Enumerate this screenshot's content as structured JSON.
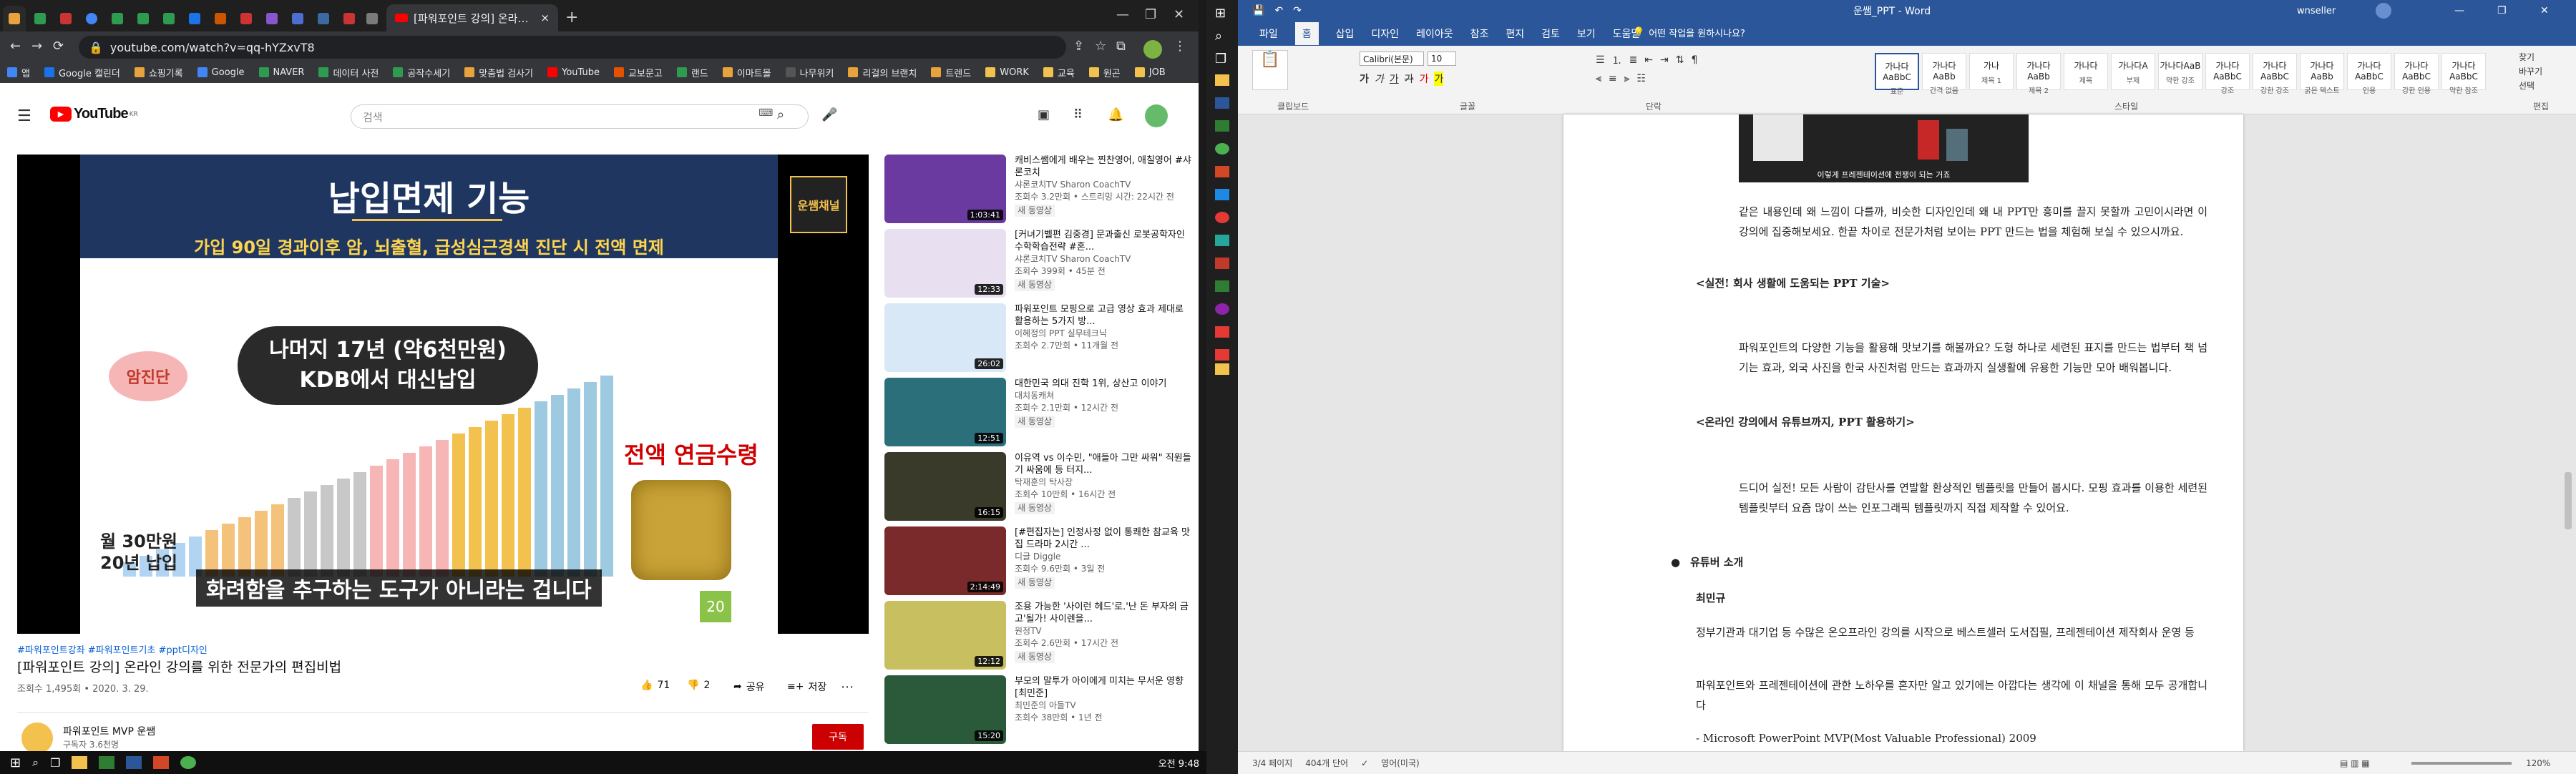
{
  "browser": {
    "active_tab_title": "[파워포인트 강의] 온라인 강의를 위한 전문가의 편집비법",
    "url": "youtube.com/watch?v=qq-hYZxvT8",
    "bookmarks": [
      "앱",
      "Google 캘린더",
      "쇼핑기록",
      "Google",
      "NAVER",
      "데이터 사전",
      "공작수세기",
      "맞춤법 검사기",
      "YouTube",
      "교보문고",
      "랜드",
      "이마트몰",
      "나무위키",
      "리걸의 브랜치",
      "트렌드",
      "WORK",
      "교육",
      "원곤",
      "JOB"
    ]
  },
  "youtube": {
    "logo": "YouTube",
    "logo_sup": "KR",
    "search_placeholder": "검색",
    "slide": {
      "title": "납입면제 기능",
      "subtitle": "가입 90일 경과이후 암, 뇌출혈, 급성심근경색 진단 시 전액 면제",
      "cancer_label": "암진단",
      "remaining": "나머지 17년 (약6천만원)",
      "remaining2": "KDB에서 대신납입",
      "annuity": "전액 연금수령",
      "monthly": "월 30만원",
      "years": "20년 납입",
      "caption": "화려함을 추구하는 도구가 아니라는 겁니다",
      "slide_number": "20",
      "channel_badge": "운쌤채널"
    },
    "hashtags": "#파워포인트강좌 #파워포인트기초 #ppt디자인",
    "video_title": "[파워포인트 강의] 온라인 강의를 위한 전문가의 편집비법",
    "video_meta": "조회수 1,495회 • 2020. 3. 29.",
    "likes": "71",
    "dislikes": "2",
    "share": "공유",
    "save": "저장",
    "channel_name": "파워포인트 MVP 운쌤",
    "subscribers": "구독자 3.6천명",
    "subscribe": "구독",
    "sidebar": [
      {
        "title": "캐비스쌤에게 배우는 찐찬영어, 애칠영어 #샤론코치",
        "channel": "샤론코치TV Sharon CoachTV",
        "meta": "조회수 3.2만회 • 스트리밍 시간: 22시간 전",
        "badge": "새 동영상",
        "duration": "1:03:41",
        "color": "#6a3aa0"
      },
      {
        "title": "[커녀기벨편 김중경] 문과출신 로봇공학자인 수학학습전략 #혼...",
        "channel": "샤론코치TV Sharon CoachTV",
        "meta": "조회수 399회 • 45분 전",
        "badge": "새 동영상",
        "duration": "12:33",
        "color": "#e8e0f0"
      },
      {
        "title": "파워포인트 모핑으로 고급 영상 효과 제대로 활용하는 5가지 방...",
        "channel": "이혜정의 PPT 실무테크닉",
        "meta": "조회수 2.7만회 • 11개월 전",
        "badge": "",
        "duration": "26:02",
        "color": "#d9e8f7"
      },
      {
        "title": "대한민국 의대 진학 1위, 상산고 이야기",
        "channel": "대치동캐쳐",
        "meta": "조회수 2.1만회 • 12시간 전",
        "badge": "새 동영상",
        "duration": "12:51",
        "color": "#2a6f7a"
      },
      {
        "title": "이유역 vs 이수민, \"애들아 그만 싸워\" 직원들 기 싸움에 등 터지...",
        "channel": "탁재훈의 탁사장",
        "meta": "조회수 10만회 • 16시간 전",
        "badge": "새 동영상",
        "duration": "16:15",
        "color": "#3a3a2a"
      },
      {
        "title": "[#편집자는] 인정사정 없이 통쾌한 참교육 맛집 드라마 2시간 ...",
        "channel": "디글 Diggle",
        "meta": "조회수 9.6만회 • 3일 전",
        "badge": "새 동영상",
        "duration": "2:14:49",
        "color": "#7a2a2a"
      },
      {
        "title": "조용 가능한 '사이런 헤드'로.'난 돈 부자의 금고'될가! 사이렌을...",
        "channel": "원정TV",
        "meta": "조회수 2.6만회 • 17시간 전",
        "badge": "새 동영상",
        "duration": "12:12",
        "color": "#c8c060"
      },
      {
        "title": "부모의 말투가 아이에게 미치는 무서운 영향 [최민준]",
        "channel": "최민준의 아들TV",
        "meta": "조회수 38만회 • 1년 전",
        "badge": "",
        "duration": "15:20",
        "color": "#2a5a3a"
      }
    ]
  },
  "taskbar_clock": "오전 9:48",
  "word": {
    "title": "운쌤_PPT - Word",
    "user": "wnseller",
    "menu": [
      "파일",
      "홈",
      "삽입",
      "디자인",
      "레이아웃",
      "참조",
      "편지",
      "검토",
      "보기",
      "도움말"
    ],
    "tell_me": "어떤 작업을 원하시나요?",
    "font_name": "Calibri(본문)",
    "font_size": "10",
    "ribbon_groups": [
      "클립보드",
      "글꼴",
      "단락",
      "스타일",
      "편집"
    ],
    "styles": [
      {
        "sample": "가나다AaBbC",
        "name": "표준"
      },
      {
        "sample": "가나다AaBb",
        "name": "간격 없음"
      },
      {
        "sample": "가나",
        "name": "제목 1"
      },
      {
        "sample": "가나다AaBb",
        "name": "제목 2"
      },
      {
        "sample": "가나다",
        "name": "제목"
      },
      {
        "sample": "가나다A",
        "name": "부제"
      },
      {
        "sample": "가나다AaB",
        "name": "약한 강조"
      },
      {
        "sample": "가나다AaBbC",
        "name": "강조"
      },
      {
        "sample": "가나다AaBbC",
        "name": "강한 강조"
      },
      {
        "sample": "가나다AaBb",
        "name": "굵은 텍스트"
      },
      {
        "sample": "가나다AaBbC",
        "name": "인용"
      },
      {
        "sample": "가나다AaBbC",
        "name": "강한 인용"
      },
      {
        "sample": "가나다AaBbC",
        "name": "약한 참조"
      }
    ],
    "ribbon_right": [
      "찾기",
      "바꾸기",
      "선택"
    ],
    "image_caption": "이렇게 프레젠테이션에 전쟁이 되는 거죠",
    "paragraphs": {
      "p1": "같은 내용인데 왜 느낌이 다를까, 비슷한 디자인인데 왜 내 PPT만 흥미를 끌지 못할까 고민이시라면 이 강의에 집중해보세요. 한끝 차이로 전문가처럼 보이는 PPT 만드는 법을 체험해 보실 수 있으시까요.",
      "h1": "<실전! 회사 생활에 도움되는 PPT 기술>",
      "p2": "파워포인트의 다양한 기능을 활용해 맛보기를 해볼까요? 도형 하나로 세련된 표지를 만드는 법부터 책 넘기는 효과, 외국 사진을 한국 사진처럼 만드는 효과까지 실생활에 유용한 기능만 모아 배워봅니다.",
      "h2": "<온라인 강의에서 유튜브까지, PPT 활용하기>",
      "p3": "드디어 실전! 모든 사람이 감탄사를 연발할 환상적인 템플릿을 만들어 봅시다. 모핑 효과를 이용한 세련된 템플릿부터 요즘 많이 쓰는 인포그래픽 템플릿까지 직접 제작할 수 있어요.",
      "bullet": "유튜버 소개",
      "name": "최민규",
      "p4": "정부기관과 대기업 등 수많은 온오프라인 강의를 시작으로 베스트셀러 도서집필, 프레젠테이션 제작회사 운영 등",
      "p5": "파워포인트와 프레젠테이션에 관한 노하우를 혼자만 알고 있기에는 아깝다는 생각에 이 채널을 통해 모두 공개합니다",
      "p6": "- Microsoft PowerPoint MVP(Most Valuable Professional) 2009"
    },
    "status_left": "3/4 페이지",
    "status_words": "404개 단어",
    "status_lang": "영어(미국)",
    "zoom": "120%"
  }
}
